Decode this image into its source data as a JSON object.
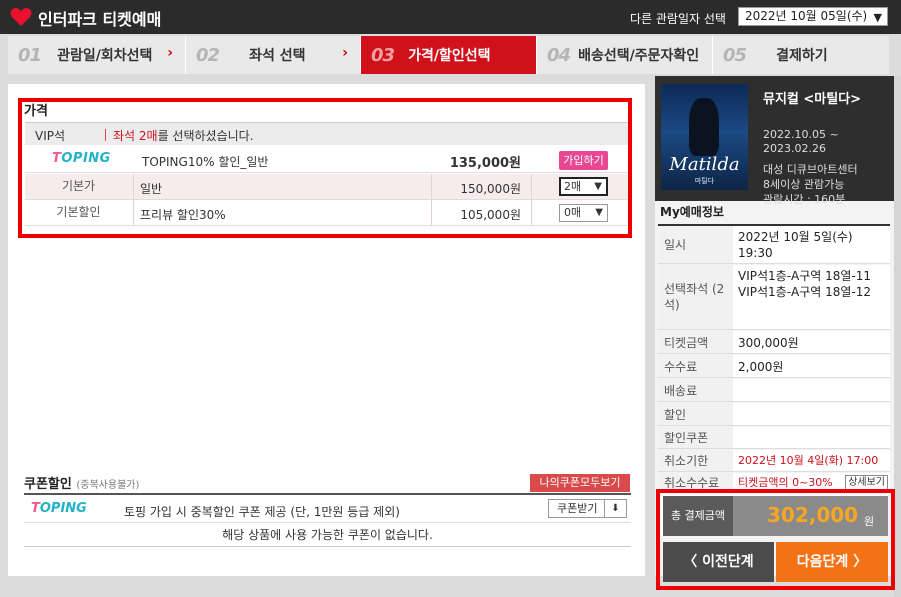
{
  "header": {
    "brand": "인터파크 티켓예매",
    "date_label": "다른 관람일자 선택",
    "date_value": "2022년 10월 05일(수)"
  },
  "steps": [
    {
      "num": "01",
      "label": "관람일/회차선택",
      "arrow": "›",
      "active": false
    },
    {
      "num": "02",
      "label": "좌석 선택",
      "arrow": "›",
      "active": false
    },
    {
      "num": "03",
      "label": "가격/할인선택",
      "arrow": "",
      "active": true
    },
    {
      "num": "04",
      "label": "배송선택/주문자확인",
      "arrow": "",
      "active": false
    },
    {
      "num": "05",
      "label": "결제하기",
      "arrow": "",
      "active": false
    }
  ],
  "price": {
    "title": "가격",
    "section": "VIP석",
    "msg_red": "좌석 2매",
    "msg_rest": "를 선택하셨습니다.",
    "toping_row": {
      "logo": "TOPING",
      "name": "TOPING10% 할인_일반",
      "amount": "135,000원",
      "button": "가입하기"
    },
    "rows": [
      {
        "head": "기본가",
        "name": "일반",
        "amount": "150,000원",
        "qty": "2매"
      },
      {
        "head": "기본할인",
        "name": "프리뷰 할인30%",
        "amount": "105,000원",
        "qty": "0매"
      }
    ]
  },
  "coupon": {
    "title": "쿠폰할인",
    "sub": "(중복사용불가)",
    "my_coupon_button": "나의쿠폰모두보기",
    "logo": "TOPING",
    "message": "토핑 가입 시 중복할인 쿠폰 제공 (단, 1만원 등급 제외)",
    "get_button": "쿠폰받기",
    "empty": "해당 상품에 사용 가능한 쿠폰이 없습니다."
  },
  "show": {
    "poster_title": "Matilda",
    "poster_kr": "마틸다",
    "title": "뮤지컬 <마틸다>",
    "period": "2022.10.05 ~ 2023.02.26",
    "venue": "대성 디큐브아트센터",
    "age": "8세이상 관람가능",
    "runtime": "관람시간 : 160분"
  },
  "my": {
    "title": "My예매정보",
    "date_head": "일시",
    "date_val": "2022년 10월 5일(수) 19:30",
    "seat_head": "선택좌석 (2석)",
    "seat1": "VIP석1층-A구역 18열-11",
    "seat2": "VIP석1층-A구역 18열-12",
    "ticket_head": "티켓금액",
    "ticket_val": "300,000원",
    "fee_head": "수수료",
    "fee_val": "2,000원",
    "delivery_head": "배송료",
    "discount_head": "할인",
    "coupon_head": "할인쿠폰",
    "cancel_head": "취소기한",
    "cancel_val": "2022년 10월 4일(화) 17:00",
    "cancelfee_head": "취소수수료",
    "cancelfee_val": "티켓금액의 0~30%",
    "detail_btn": "상세보기"
  },
  "total": {
    "label": "총 결제금액",
    "value": "302,000",
    "unit": "원"
  },
  "nav": {
    "prev": "〈  이전단계",
    "next": "다음단계  〉"
  },
  "colors": {
    "brand_red": "#d0101b",
    "accent_orange": "#f47216",
    "price_gold": "#f6a623",
    "toping_cyan": "#22b3c9"
  }
}
